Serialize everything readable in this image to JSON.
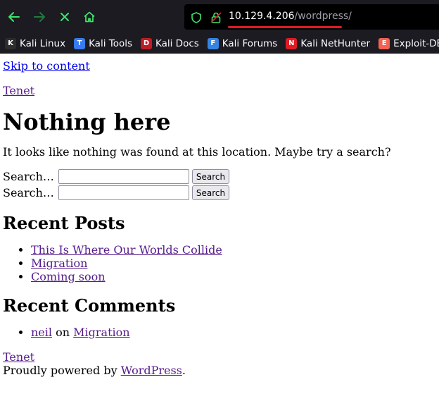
{
  "browser": {
    "url_host": "10.129.4.206",
    "url_path": "/wordpress/",
    "bookmarks": [
      {
        "label": "Kali Linux",
        "icon": "kali-dragon-icon",
        "color": "#2d2d2d"
      },
      {
        "label": "Kali Tools",
        "icon": "kali-tools-icon",
        "color": "#367bf0"
      },
      {
        "label": "Kali Docs",
        "icon": "kali-docs-icon",
        "color": "#c01c28"
      },
      {
        "label": "Kali Forums",
        "icon": "kali-forums-icon",
        "color": "#3584e4"
      },
      {
        "label": "Kali NetHunter",
        "icon": "nethunter-icon",
        "color": "#e01b24"
      },
      {
        "label": "Exploit-DB",
        "icon": "exploit-db-icon",
        "color": "#f66151"
      }
    ]
  },
  "page": {
    "skip_link": "Skip to content",
    "site_title": "Tenet",
    "heading": "Nothing here",
    "message": "It looks like nothing was found at this location. Maybe try a search?",
    "search_label": "Search…",
    "search_button": "Search",
    "recent_posts_heading": "Recent Posts",
    "recent_posts": [
      "This Is Where Our Worlds Collide",
      "Migration",
      "Coming soon"
    ],
    "recent_comments_heading": "Recent Comments",
    "comment": {
      "author": "neil",
      "on": "on",
      "post": "Migration"
    },
    "footer_site": "Tenet",
    "powered_prefix": "Proudly powered by",
    "powered_link": "WordPress",
    "powered_suffix": "."
  }
}
